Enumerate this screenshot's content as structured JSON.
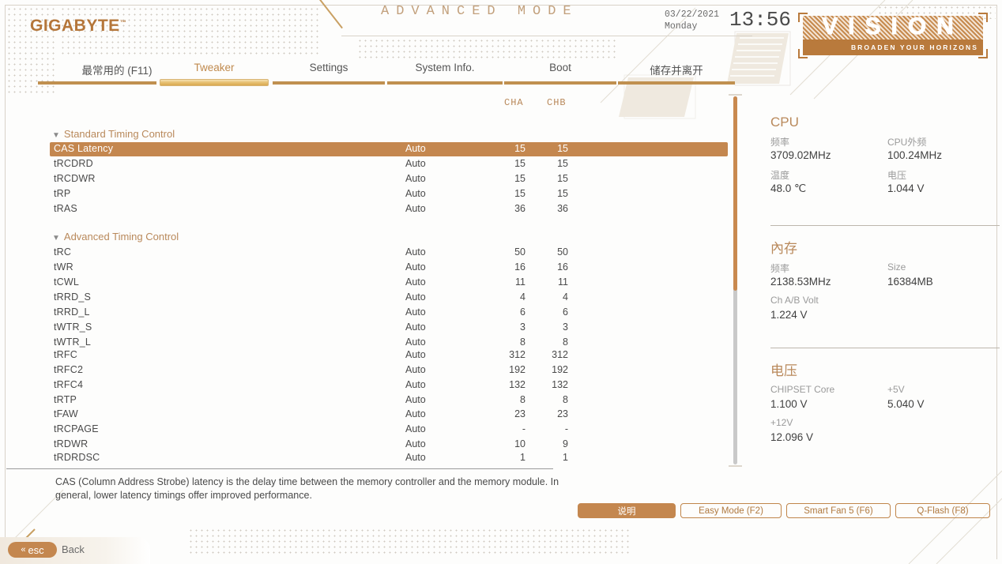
{
  "header": {
    "brand": "GIGABYTE",
    "brand_tm": "™",
    "mode_title": "ADVANCED MODE",
    "date": "03/22/2021",
    "weekday": "Monday",
    "time": "13:56",
    "vision_word": "VISION",
    "vision_tagline": "BROADEN YOUR HORIZONS",
    "accent": "#c4874f",
    "brand_color": "#b5763a"
  },
  "nav": {
    "tabs": [
      {
        "label": "最常用的 (F11)",
        "active": false
      },
      {
        "label": "Tweaker",
        "active": true
      },
      {
        "label": "Settings",
        "active": false
      },
      {
        "label": "System Info.",
        "active": false
      },
      {
        "label": "Boot",
        "active": false
      },
      {
        "label": "储存并离开",
        "active": false
      }
    ]
  },
  "main": {
    "column_headers": {
      "cha": "CHA",
      "chb": "CHB"
    },
    "sections": [
      {
        "title": "Standard Timing Control",
        "caret": "▼",
        "rows": [
          {
            "name": "CAS Latency",
            "value": "Auto",
            "cha": "15",
            "chb": "15",
            "selected": true
          },
          {
            "name": "tRCDRD",
            "value": "Auto",
            "cha": "15",
            "chb": "15",
            "selected": false
          },
          {
            "name": "tRCDWR",
            "value": "Auto",
            "cha": "15",
            "chb": "15",
            "selected": false
          },
          {
            "name": "tRP",
            "value": "Auto",
            "cha": "15",
            "chb": "15",
            "selected": false
          },
          {
            "name": "tRAS",
            "value": "Auto",
            "cha": "36",
            "chb": "36",
            "selected": false
          }
        ]
      },
      {
        "title": "Advanced Timing Control",
        "caret": "▼",
        "rows": [
          {
            "name": "tRC",
            "value": "Auto",
            "cha": "50",
            "chb": "50",
            "selected": false
          },
          {
            "name": "tWR",
            "value": "Auto",
            "cha": "16",
            "chb": "16",
            "selected": false
          },
          {
            "name": "tCWL",
            "value": "Auto",
            "cha": "11",
            "chb": "11",
            "selected": false
          },
          {
            "name": "tRRD_S",
            "value": "Auto",
            "cha": "4",
            "chb": "4",
            "selected": false
          },
          {
            "name": "tRRD_L",
            "value": "Auto",
            "cha": "6",
            "chb": "6",
            "selected": false
          },
          {
            "name": "tWTR_S",
            "value": "Auto",
            "cha": "3",
            "chb": "3",
            "selected": false
          },
          {
            "name": "tWTR_L",
            "value": "Auto",
            "cha": "8",
            "chb": "8",
            "selected": false
          },
          {
            "name": "tRFC",
            "value": "Auto",
            "cha": "312",
            "chb": "312",
            "selected": false
          },
          {
            "name": "tRFC2",
            "value": "Auto",
            "cha": "192",
            "chb": "192",
            "selected": false
          },
          {
            "name": "tRFC4",
            "value": "Auto",
            "cha": "132",
            "chb": "132",
            "selected": false
          },
          {
            "name": "tRTP",
            "value": "Auto",
            "cha": "8",
            "chb": "8",
            "selected": false
          },
          {
            "name": "tFAW",
            "value": "Auto",
            "cha": "23",
            "chb": "23",
            "selected": false
          },
          {
            "name": "tRCPAGE",
            "value": "Auto",
            "cha": "-",
            "chb": "-",
            "selected": false
          },
          {
            "name": "tRDWR",
            "value": "Auto",
            "cha": "10",
            "chb": "9",
            "selected": false
          },
          {
            "name": "tRDRDSC",
            "value": "Auto",
            "cha": "1",
            "chb": "1",
            "selected": false
          }
        ]
      }
    ]
  },
  "help": {
    "text": "CAS (Column Address Strobe) latency is the delay time between the memory controller and the memory module. In general, lower latency timings offer improved performance."
  },
  "info_panels": [
    {
      "title": "CPU",
      "pairs": [
        {
          "k1": "频率",
          "v1": "3709.02MHz",
          "k2": "CPU外频",
          "v2": "100.24MHz"
        },
        {
          "k1": "温度",
          "v1": "48.0 ℃",
          "k2": "电压",
          "v2": "1.044 V"
        }
      ]
    },
    {
      "title": "內存",
      "pairs": [
        {
          "k1": "频率",
          "v1": "2138.53MHz",
          "k2": "Size",
          "v2": "16384MB"
        },
        {
          "k1": "Ch A/B Volt",
          "v1": "1.224 V",
          "k2": "",
          "v2": ""
        }
      ]
    },
    {
      "title": "电压",
      "pairs": [
        {
          "k1": "CHIPSET Core",
          "v1": "1.100 V",
          "k2": "+5V",
          "v2": "5.040 V"
        },
        {
          "k1": "+12V",
          "v1": "12.096 V",
          "k2": "",
          "v2": ""
        }
      ]
    }
  ],
  "buttons": [
    {
      "label": "说明",
      "filled": true
    },
    {
      "label": "Easy Mode (F2)",
      "filled": false
    },
    {
      "label": "Smart Fan 5 (F6)",
      "filled": false
    },
    {
      "label": "Q-Flash (F8)",
      "filled": false
    }
  ],
  "footer": {
    "esc_chevron": "«",
    "esc_label": "esc",
    "back_label": "Back"
  }
}
